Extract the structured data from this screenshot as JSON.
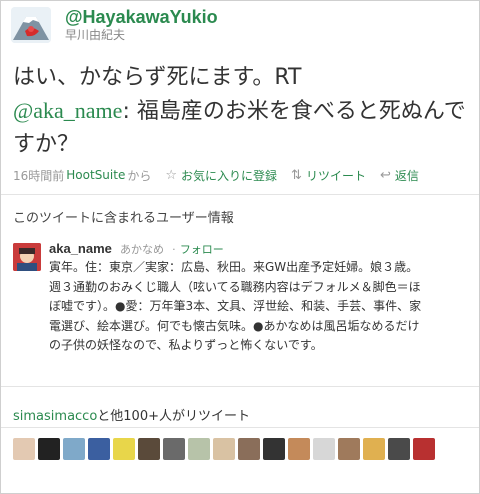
{
  "tweet": {
    "handle": "@HayakawaYukio",
    "real_name": "早川由紀夫",
    "text_before": "はい、かならず死にます。RT",
    "mention": "@aka_name",
    "text_after": ": 福島産のお米を食べると死ぬんですか？",
    "time": "16時間前",
    "app": "HootSuite",
    "from_suffix": "から",
    "favorite_label": "お気に入りに登録",
    "retweet_label": "リツイート",
    "reply_label": "返信"
  },
  "section_title": "このツイートに含まれるユーザー情報",
  "user": {
    "username": "aka_name",
    "real_name": "あかなめ",
    "separator": "·",
    "follow_label": "フォロー",
    "bio": "寅年。住：東京／実家：広島、秋田。来GW出産予定妊婦。娘３歳。週３通勤のおみくじ職人（呟いてる職務内容はデフォルメ＆脚色＝ほぼ嘘です）。●愛：万年筆3本、文具、浮世絵、和装、手芸、事件、家電選び、絵本選び。何でも懐古気味。●あかなめは風呂垢なめるだけの子供の妖怪なので、私よりずっと怖くないです。"
  },
  "retweet_summary": {
    "user": "simasimacco",
    "suffix": "と他100+人がリツイート"
  },
  "icons": {
    "favorite": "star-icon",
    "retweet": "retweet-icon",
    "reply": "reply-arrow-icon"
  },
  "colors": {
    "accent": "#2b8a4f",
    "muted": "#999999"
  }
}
